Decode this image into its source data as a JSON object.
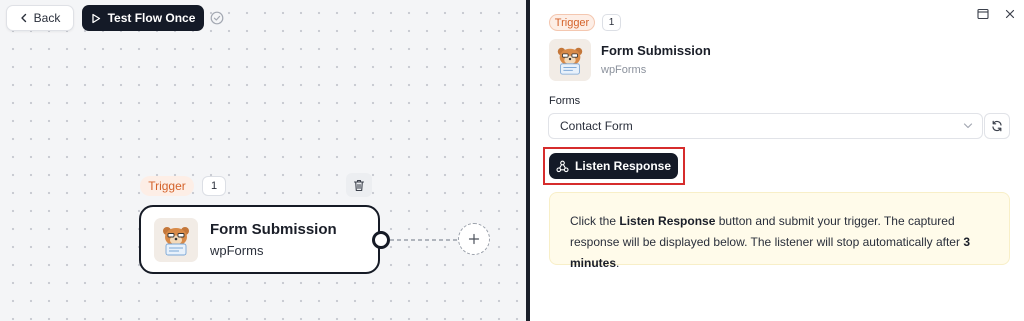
{
  "toolbar": {
    "back_label": "Back",
    "test_label": "Test Flow Once"
  },
  "canvas": {
    "trigger_badge": "Trigger",
    "step_count": "1",
    "node": {
      "title": "Form Submission",
      "subtitle": "wpForms"
    }
  },
  "panel": {
    "trigger_badge": "Trigger",
    "step_count": "1",
    "title": "Form Submission",
    "subtitle": "wpForms",
    "forms_label": "Forms",
    "forms_value": "Contact Form",
    "listen_button": "Listen Response",
    "info": {
      "part1": "Click the ",
      "bold1": "Listen Response",
      "part2": " button and submit your trigger. The captured response will be displayed below. The listener will stop automatically after ",
      "bold2": "3 minutes",
      "part3": "."
    }
  },
  "colors": {
    "dark": "#141a27",
    "trigger_orange": "#d4622a",
    "trigger_bg": "#fdeee6",
    "info_bg": "#fffbea",
    "highlight_red": "#d62c2c"
  },
  "icons": [
    "chevron-left-icon",
    "play-icon",
    "check-circle-icon",
    "trash-icon",
    "plus-icon",
    "maximize-icon",
    "close-icon",
    "chevron-down-icon",
    "refresh-icon",
    "webhook-icon",
    "wpforms-logo"
  ]
}
